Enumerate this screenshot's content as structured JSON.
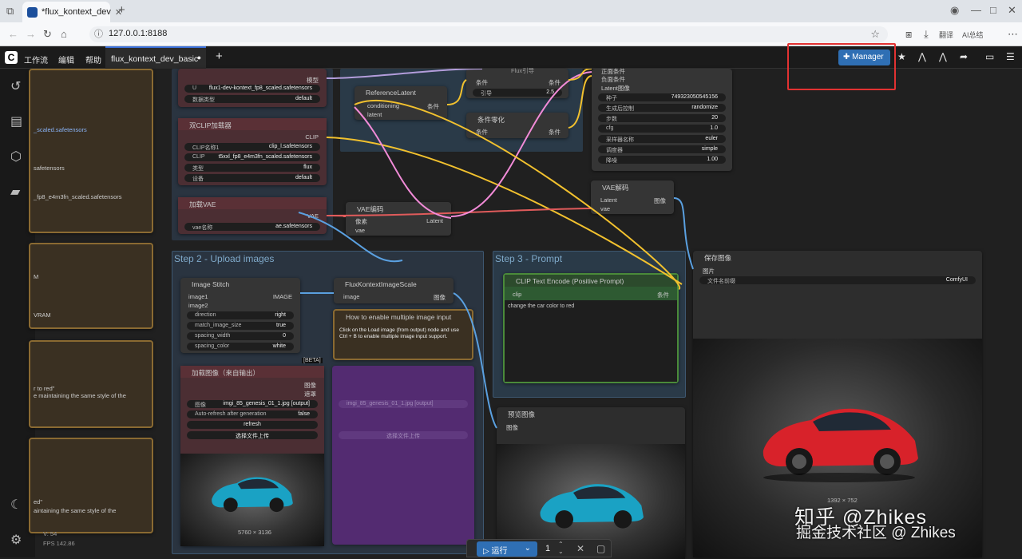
{
  "browser": {
    "tab_title": "*flux_kontext_dev",
    "url": "127.0.0.1:8188",
    "translate_label": "翻译",
    "ai_label": "AI总结"
  },
  "menubar": {
    "items": [
      "工作流",
      "编辑",
      "帮助"
    ],
    "doc_tab": "flux_kontext_dev_basic",
    "manager_label": "Manager"
  },
  "sidebar_partial": {
    "t1": "_scaled.safetensors",
    "t2": "safetensors",
    "t3": "_fp8_e4m3fn_scaled.safetensors",
    "t4": "M",
    "t5": "VRAM",
    "t6": "r to red\"",
    "t7": "e maintaining the same style of the",
    "t8": "ed\"",
    "t9": "aintaining the same style of the",
    "stat1": "V: 54",
    "stat2": "FPS 142.86"
  },
  "nodes": {
    "unet": {
      "field1_label": "U",
      "field1": "flux1-dev-kontext_fp8_scaled.safetensors",
      "field2_label": "数据类型",
      "field2": "default",
      "out": "模型"
    },
    "dualclip": {
      "title": "双CLIP加载器",
      "out": "CLIP",
      "f1l": "CLIP名称1",
      "f1": "clip_l.safetensors",
      "f2l": "CLIP",
      "f2": "t5xxl_fp8_e4m3fn_scaled.safetensors",
      "f3l": "类型",
      "f3": "flux",
      "f4l": "设备",
      "f4": "default"
    },
    "vaeload": {
      "title": "加载VAE",
      "out": "VAE",
      "f1l": "vae名称",
      "f1": "ae.safetensors"
    },
    "reflatent": {
      "title": "ReferenceLatent",
      "in1": "conditioning",
      "in2": "latent",
      "out": "条件"
    },
    "guidance": {
      "title": "Flux引导",
      "in1": "条件",
      "out": "条件",
      "f1l": "引导",
      "f1": "2.5"
    },
    "zero": {
      "title": "条件零化",
      "in1": "条件",
      "out": "条件"
    },
    "ksampler": {
      "in1": "正面条件",
      "in2": "负面条件",
      "in3": "Latent图像",
      "f1l": "种子",
      "f1": "749323050545156",
      "f2l": "生成后控制",
      "f2": "randomize",
      "f3l": "步数",
      "f3": "20",
      "f4l": "cfg",
      "f4": "1.0",
      "f5l": "采样器名称",
      "f5": "euler",
      "f6l": "调度器",
      "f6": "simple",
      "f7l": "降噪",
      "f7": "1.00"
    },
    "vaeenc": {
      "title": "VAE编码",
      "in1": "像素",
      "in2": "vae",
      "out": "Latent"
    },
    "vaedec": {
      "title": "VAE解码",
      "in1": "Latent",
      "in2": "vae",
      "out": "图像"
    },
    "save": {
      "title": "保存图像",
      "in1": "图片",
      "f1l": "文件名前缀",
      "f1": "ComfyUI",
      "size": "1392 × 752"
    },
    "stitch": {
      "title": "Image Stitch",
      "in1": "image1",
      "in2": "image2",
      "out": "IMAGE",
      "f1l": "direction",
      "f1": "right",
      "f2l": "match_image_size",
      "f2": "true",
      "f3l": "spacing_width",
      "f3": "0",
      "f4l": "spacing_color",
      "f4": "white"
    },
    "scale": {
      "title": "FluxKontextImageScale",
      "in1": "image",
      "out": "图像"
    },
    "howto": {
      "title": "How to enable multiple image input",
      "text": "Click on the Load image (from output) node and use Ctrl + B to enable multiple image input support."
    },
    "load": {
      "title": "加载图像（来自输出）",
      "badge": "[BETA]",
      "out1": "图像",
      "out2": "遮罩",
      "f1l": "图像",
      "f1": "imgi_85_genesis_01_1.jpg [output]",
      "f2l": "Auto-refresh after generation",
      "f2": "false",
      "btn1": "refresh",
      "btn2": "选择文件上传",
      "size": "5760 × 3136"
    },
    "load2": {
      "f1": "imgi_85_genesis_01_1.jpg [output]",
      "btn": "选择文件上传"
    },
    "clip": {
      "title": "CLIP Text Encode (Positive Prompt)",
      "in1": "clip",
      "out": "条件",
      "text": "change the car color to red"
    },
    "preview": {
      "title": "预览图像",
      "in1": "图像"
    }
  },
  "groups": {
    "step2": "Step 2 - Upload images",
    "step3": "Step 3 - Prompt"
  },
  "bottombar": {
    "run_label": "运行",
    "count": "1"
  },
  "watermark": {
    "line1": "知乎 @Zhikes",
    "line2": "掘金技术社区 @ Zhikes"
  },
  "colors": {
    "accent": "#2f6fb4",
    "highlight": "#e23232"
  }
}
